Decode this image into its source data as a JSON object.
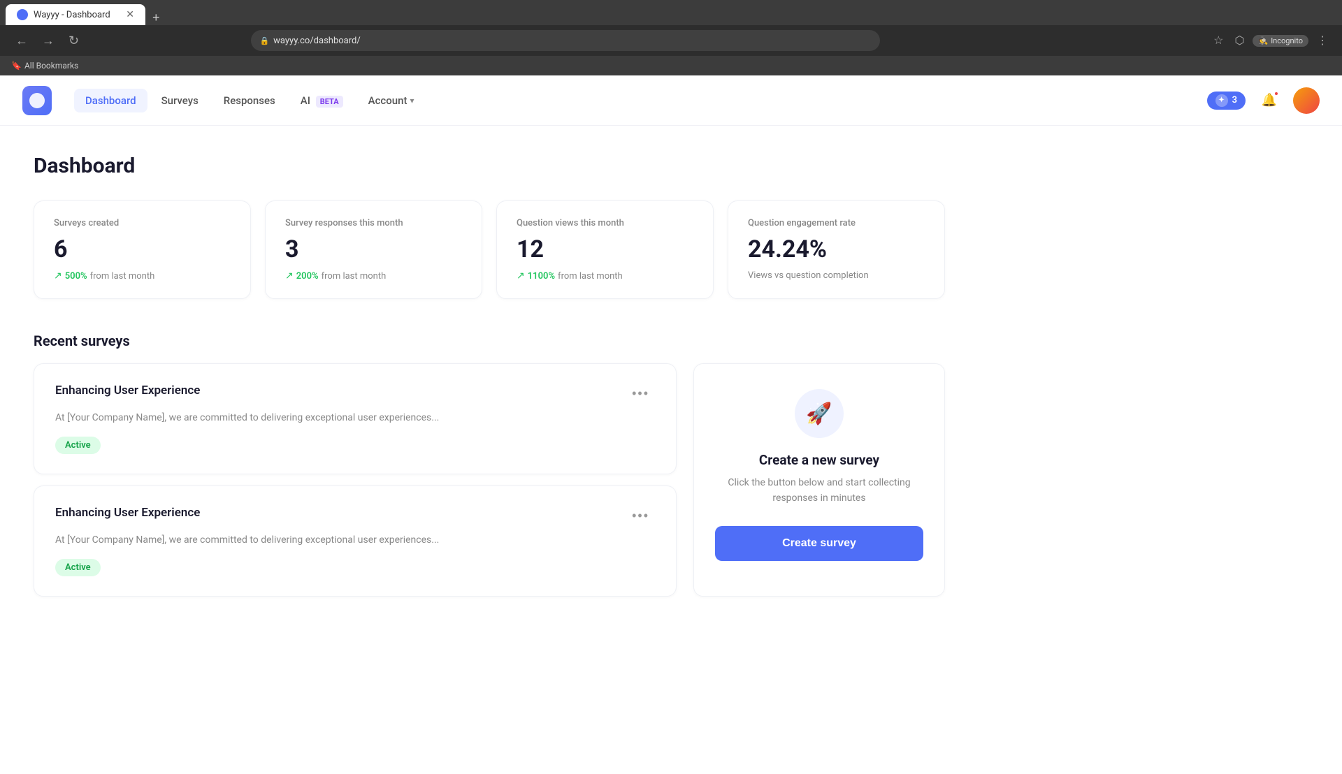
{
  "browser": {
    "tab_title": "Wayyy - Dashboard",
    "url": "wayyy.co/dashboard/",
    "new_tab_label": "+",
    "incognito_label": "Incognito",
    "bookmarks_label": "All Bookmarks"
  },
  "nav": {
    "logo_alt": "Wayyy logo",
    "links": [
      {
        "id": "dashboard",
        "label": "Dashboard",
        "active": true
      },
      {
        "id": "surveys",
        "label": "Surveys",
        "active": false
      },
      {
        "id": "responses",
        "label": "Responses",
        "active": false
      },
      {
        "id": "ai",
        "label": "AI",
        "active": false
      },
      {
        "id": "account",
        "label": "Account",
        "active": false
      }
    ],
    "ai_badge": "BETA",
    "account_chevron": "▾",
    "badge_count": "3",
    "notification_tooltip": "Notifications"
  },
  "page": {
    "title": "Dashboard"
  },
  "stats": [
    {
      "id": "surveys-created",
      "label": "Surveys created",
      "value": "6",
      "change_pct": "500%",
      "change_label": "from last month"
    },
    {
      "id": "survey-responses",
      "label": "Survey responses this month",
      "value": "3",
      "change_pct": "200%",
      "change_label": "from last month"
    },
    {
      "id": "question-views",
      "label": "Question views this month",
      "value": "12",
      "change_pct": "1100%",
      "change_label": "from last month"
    },
    {
      "id": "engagement-rate",
      "label": "Question engagement rate",
      "value": "24.24%",
      "change_label": "Views vs question completion"
    }
  ],
  "recent_surveys": {
    "section_title": "Recent surveys",
    "items": [
      {
        "id": "survey-1",
        "title": "Enhancing User Experience",
        "description": "At [Your Company Name], we are committed to delivering exceptional user experiences...",
        "status": "Active"
      },
      {
        "id": "survey-2",
        "title": "Enhancing User Experience",
        "description": "At [Your Company Name], we are committed to delivering exceptional user experiences...",
        "status": "Active"
      }
    ],
    "more_button_label": "•••"
  },
  "create_panel": {
    "icon": "🚀",
    "title": "Create a new survey",
    "description": "Click the button below and start collecting responses in minutes",
    "button_label": "Create survey"
  }
}
